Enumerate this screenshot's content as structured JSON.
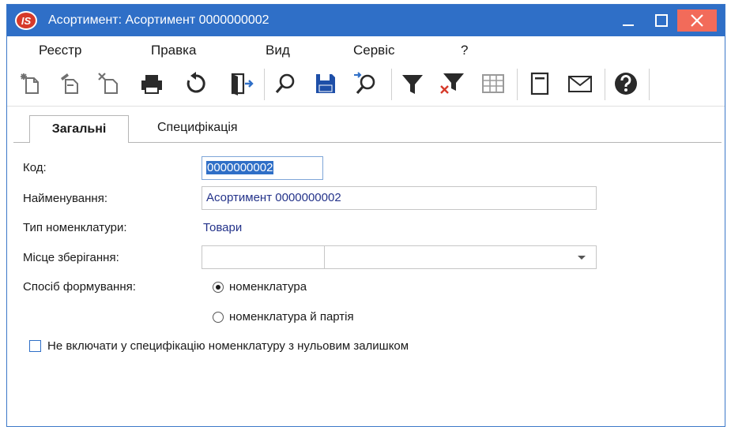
{
  "window": {
    "title": "Асортимент: Асортимент 0000000002",
    "logo_text": "IS"
  },
  "menu": [
    "Реєстр",
    "Правка",
    "Вид",
    "Сервіс",
    "?"
  ],
  "toolbar": {
    "icons": [
      "create-icon",
      "copy-icon",
      "delete-icon",
      "print-icon",
      "refresh-icon",
      "exit-icon",
      "search-icon",
      "save-icon",
      "search-next-icon",
      "filter-icon",
      "clear-filter-icon",
      "table-icon",
      "form-icon",
      "mail-icon",
      "help-icon"
    ]
  },
  "tabs": [
    {
      "label": "Загальні",
      "active": true
    },
    {
      "label": "Специфікація",
      "active": false
    }
  ],
  "form": {
    "code_label": "Код:",
    "code_value": "0000000002",
    "name_label": "Найменування:",
    "name_value": "Асортимент 0000000002",
    "type_label": "Тип номенклатури:",
    "type_value": "Товари",
    "storage_label": "Місце зберігання:",
    "storage_code": "",
    "storage_name": "",
    "method_label": "Спосіб формування:",
    "method_options": [
      {
        "label": "номенклатура",
        "selected": true
      },
      {
        "label": "номенклатура й партія",
        "selected": false
      }
    ],
    "exclude_zero_label": "Не включати у специфікацію номенклатуру з нульовим залишком",
    "exclude_zero_checked": false
  },
  "colors": {
    "titlebar": "#2f6fc7",
    "close_button": "#f26b5a",
    "value_text": "#24338a"
  }
}
